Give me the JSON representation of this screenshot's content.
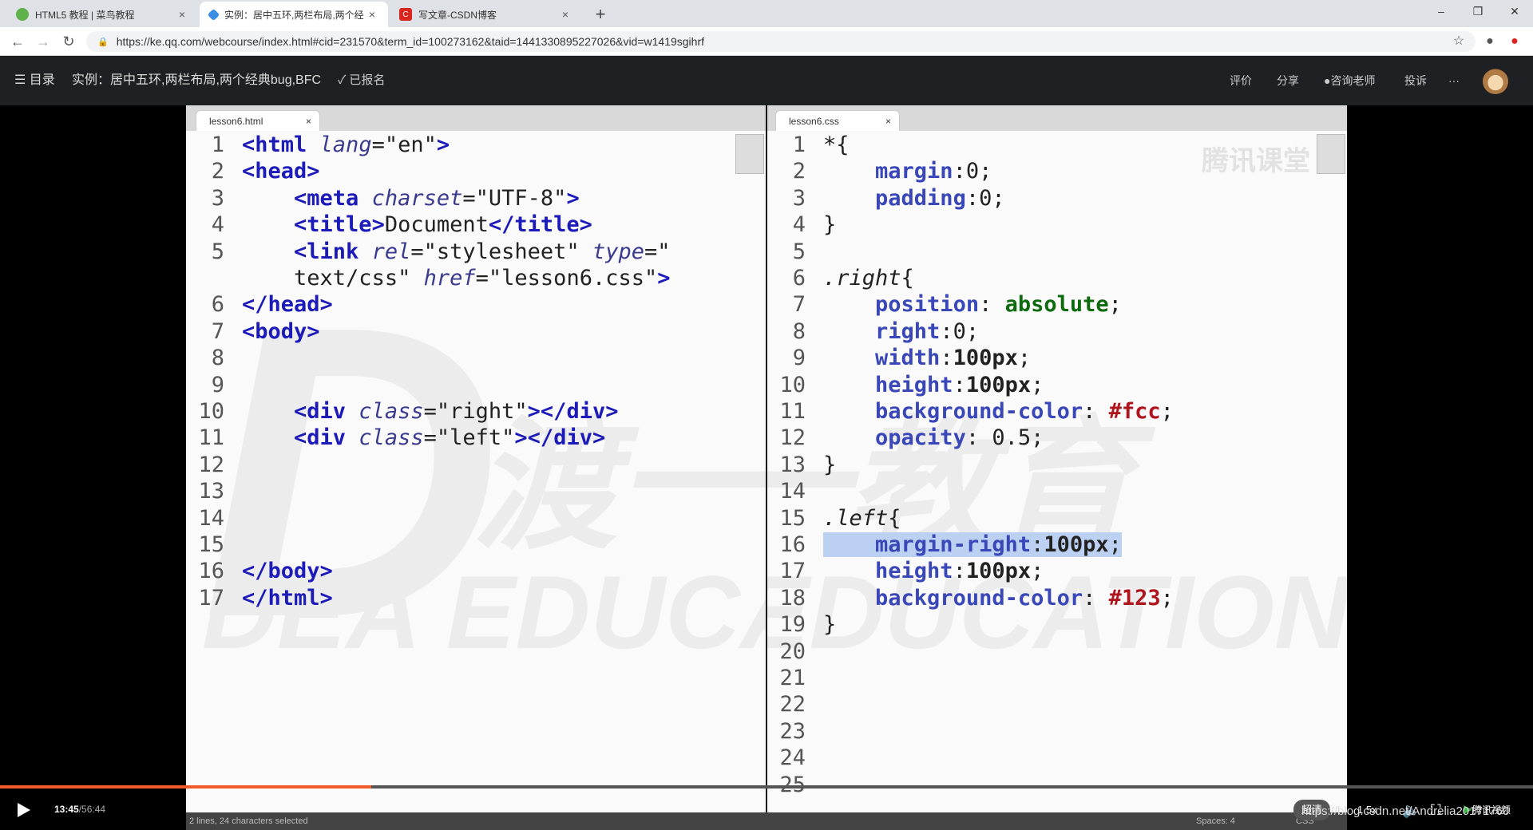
{
  "browser": {
    "tabs": [
      {
        "title": "HTML5 教程 | 菜鸟教程",
        "close": "×",
        "icon_color": "#5fb14b"
      },
      {
        "title": "实例：居中五环,两栏布局,两个经",
        "close": "×",
        "icon_color": "#3a8ee6"
      },
      {
        "title": "写文章-CSDN博客",
        "close": "×",
        "icon_color": "#d9251d"
      }
    ],
    "new_tab": "+",
    "window": {
      "minimize": "–",
      "restore": "❐",
      "close": "✕"
    },
    "url": "https://ke.qq.com/webcourse/index.html#cid=231570&term_id=100273162&taid=1441330895227026&vid=w1419sgihrf"
  },
  "header": {
    "menu_label": "☰ 目录",
    "title": "实例：居中五环,两栏布局,两个经典bug,BFC",
    "enrolled": "✓ 已报名",
    "actions": [
      "评价",
      "分享",
      "咨询老师",
      "投诉",
      "···"
    ]
  },
  "editor": {
    "left": {
      "filename": "lesson6.html",
      "close": "×",
      "lines": [
        {
          "n": "1",
          "html": "<span class='t'>&lt;html</span> <span class='a'>lang</span>=<span class='s'>\"en\"</span><span class='t'>&gt;</span>"
        },
        {
          "n": "2",
          "html": "<span class='t'>&lt;head&gt;</span>"
        },
        {
          "n": "3",
          "html": "    <span class='t'>&lt;meta</span> <span class='a'>charset</span>=<span class='s'>\"UTF-8\"</span><span class='t'>&gt;</span>"
        },
        {
          "n": "4",
          "html": "    <span class='t'>&lt;title&gt;</span>Document<span class='t'>&lt;/title&gt;</span>"
        },
        {
          "n": "5",
          "html": "    <span class='t'>&lt;link</span> <span class='a'>rel</span>=<span class='s'>\"stylesheet\"</span> <span class='a'>type</span>=<span class='s'>\"</span>"
        },
        {
          "n": "",
          "html": "    <span class='s'>text/css\"</span> <span class='a'>href</span>=<span class='s'>\"lesson6.css\"</span><span class='t'>&gt;</span>"
        },
        {
          "n": "6",
          "html": "<span class='t'>&lt;/head&gt;</span>"
        },
        {
          "n": "7",
          "html": "<span class='t'>&lt;body&gt;</span>"
        },
        {
          "n": "8",
          "html": ""
        },
        {
          "n": "9",
          "html": ""
        },
        {
          "n": "10",
          "html": "    <span class='t'>&lt;div</span> <span class='a'>class</span>=<span class='s'>\"right\"</span><span class='t'>&gt;&lt;/div&gt;</span>"
        },
        {
          "n": "11",
          "html": "    <span class='t'>&lt;div</span> <span class='a'>class</span>=<span class='s'>\"left\"</span><span class='t'>&gt;&lt;/div&gt;</span>"
        },
        {
          "n": "12",
          "html": ""
        },
        {
          "n": "13",
          "html": ""
        },
        {
          "n": "14",
          "html": ""
        },
        {
          "n": "15",
          "html": ""
        },
        {
          "n": "16",
          "html": "<span class='t'>&lt;/body&gt;</span>"
        },
        {
          "n": "17",
          "html": "<span class='t'>&lt;/html&gt;</span>"
        }
      ]
    },
    "right": {
      "filename": "lesson6.css",
      "close": "×",
      "lines": [
        {
          "n": "1",
          "html": "*{"
        },
        {
          "n": "2",
          "html": "    <span class='p'>margin</span>:0;"
        },
        {
          "n": "3",
          "html": "    <span class='p'>padding</span>:0;"
        },
        {
          "n": "4",
          "html": "}"
        },
        {
          "n": "5",
          "html": ""
        },
        {
          "n": "6",
          "html": "<i>.right</i>{"
        },
        {
          "n": "7",
          "html": "    <span class='p'>position</span>: <span class='v'>absolute</span>;"
        },
        {
          "n": "8",
          "html": "    <span class='p'>right</span>:0;"
        },
        {
          "n": "9",
          "html": "    <span class='p'>width</span>:<b>100px</b>;"
        },
        {
          "n": "10",
          "html": "    <span class='p'>height</span>:<b>100px</b>;"
        },
        {
          "n": "11",
          "html": "    <span class='p'>background-color</span>: <span class='c'>#fcc</span>;"
        },
        {
          "n": "12",
          "html": "    <span class='p'>opacity</span>: 0.5;"
        },
        {
          "n": "13",
          "html": "}"
        },
        {
          "n": "14",
          "html": ""
        },
        {
          "n": "15",
          "html": "<i>.left</i>{"
        },
        {
          "n": "16",
          "html": "<span class='sel'>    <span class='p'>margin-right</span>:<b>100px</b>;</span>"
        },
        {
          "n": "17",
          "html": "    <span class='p'>height</span>:<b>100px</b>;"
        },
        {
          "n": "18",
          "html": "    <span class='p'>background-color</span>: <span class='c'>#123</span>;"
        },
        {
          "n": "19",
          "html": "}"
        },
        {
          "n": "20",
          "html": ""
        },
        {
          "n": "21",
          "html": ""
        },
        {
          "n": "22",
          "html": ""
        },
        {
          "n": "23",
          "html": ""
        },
        {
          "n": "24",
          "html": ""
        },
        {
          "n": "25",
          "html": ""
        }
      ]
    },
    "status_left": "2 lines, 24 characters selected",
    "status_spaces": "Spaces: 4",
    "status_lang": "CSS"
  },
  "watermarks": {
    "brand": "腾讯课堂",
    "edu_cn": "渡一教育",
    "edu_en": "DEA EDUCATION"
  },
  "player": {
    "current": "13:45",
    "total": "/56:44",
    "progress_fraction": 0.242,
    "quality": "超清",
    "speed": "1.5x",
    "source": "腾讯视频",
    "credit": "https://blog.csdn.net/Andrelia20171760"
  },
  "colors": {
    "accent": "#f25a29",
    "header_bg": "#1f2023"
  }
}
